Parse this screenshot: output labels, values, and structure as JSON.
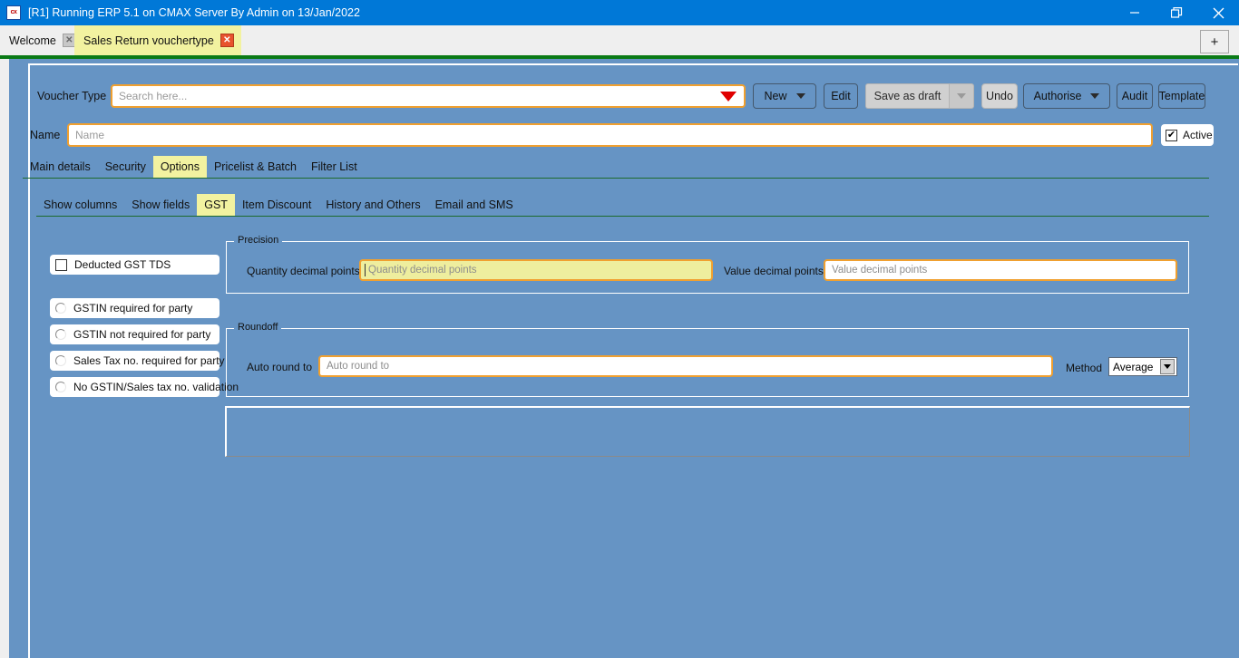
{
  "window": {
    "title": "[R1] Running ERP 5.1 on CMAX Server By Admin on 13/Jan/2022",
    "app_icon": "cx",
    "minimize_icon": "minimize-icon",
    "restore_icon": "restore-icon",
    "close_icon": "close-icon"
  },
  "tabstrip": {
    "tabs": [
      {
        "label": "Welcome",
        "close": "✕",
        "active": false
      },
      {
        "label": "Sales Return vouchertype",
        "close": "✕",
        "active": true
      }
    ],
    "add_tab_label": "+"
  },
  "toolbar": {
    "voucher_type_label": "Voucher Type",
    "search_placeholder": "Search here...",
    "search_value": "",
    "dropdown_icon": "caret-down-icon",
    "buttons": [
      {
        "label": "New",
        "has_arrow": true
      },
      {
        "label": "Edit",
        "has_arrow": false
      },
      {
        "label": "Save as draft",
        "has_arrow": false
      },
      {
        "label": "Undo",
        "has_arrow": false
      },
      {
        "label": "Authorise",
        "has_arrow": true
      },
      {
        "label": "Audit",
        "has_arrow": false
      },
      {
        "label": "Template",
        "has_arrow": false
      }
    ]
  },
  "name_row": {
    "label": "Name",
    "placeholder": "Name",
    "value": "",
    "active_label": "Active",
    "active_checked": true,
    "active_mark": "✔"
  },
  "primary_tabs": [
    {
      "label": "Main details",
      "active": false
    },
    {
      "label": "Security",
      "active": false
    },
    {
      "label": "Options",
      "active": true
    },
    {
      "label": "Pricelist & Batch",
      "active": false
    },
    {
      "label": "Filter List",
      "active": false
    }
  ],
  "secondary_tabs": [
    {
      "label": "Show columns",
      "active": false
    },
    {
      "label": "Show fields",
      "active": false
    },
    {
      "label": "GST",
      "active": true
    },
    {
      "label": "Item Discount",
      "active": false
    },
    {
      "label": "History and Others",
      "active": false
    },
    {
      "label": "Email and SMS",
      "active": false
    }
  ],
  "options": {
    "checkbox": {
      "label": "Deducted GST TDS",
      "checked": false
    },
    "radios": [
      {
        "label": "GSTIN required for party",
        "selected": false
      },
      {
        "label": "GSTIN not required for party",
        "selected": false
      },
      {
        "label": "Sales Tax no. required for party",
        "selected": false
      },
      {
        "label": "No GSTIN/Sales tax no. validation",
        "selected": false
      }
    ]
  },
  "precision": {
    "legend": "Precision",
    "quantity_label": "Quantity decimal points",
    "quantity_placeholder": "Quantity decimal points",
    "quantity_value": "",
    "value_label": "Value decimal points",
    "value_placeholder": "Value decimal points",
    "value_value": ""
  },
  "roundoff": {
    "legend": "Roundoff",
    "auto_round_label": "Auto round to",
    "auto_round_placeholder": "Auto round to",
    "auto_round_value": "",
    "method_label": "Method",
    "method_value": "Average",
    "method_options": [
      "Average"
    ]
  },
  "colors": {
    "titlebar": "#0078d7",
    "form_background": "#6694c4",
    "active_tab": "#f2f2a0",
    "field_border": "#f0a030",
    "highlight_field": "#eeee9e",
    "green_rule": "#0a7a16",
    "close_red": "#e8522d"
  }
}
